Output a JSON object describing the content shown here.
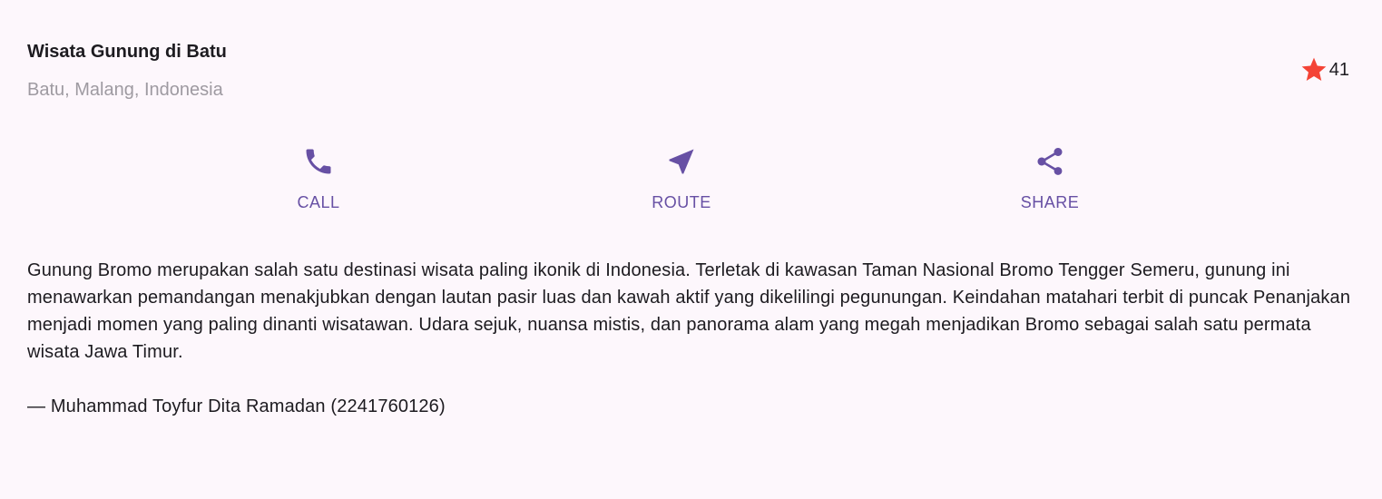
{
  "header": {
    "title": "Wisata Gunung di Batu",
    "location": "Batu, Malang, Indonesia",
    "rating_count": "41",
    "rating_icon": "star-icon",
    "rating_color": "#f44336"
  },
  "actions": [
    {
      "label": "CALL",
      "icon": "phone-icon"
    },
    {
      "label": "ROUTE",
      "icon": "navigation-arrow-icon"
    },
    {
      "label": "SHARE",
      "icon": "share-icon"
    }
  ],
  "accent_color": "#6750a4",
  "description": {
    "text": "Gunung Bromo merupakan salah satu destinasi wisata paling ikonik di Indonesia. Terletak di kawasan Taman Nasional Bromo Tengger Semeru, gunung ini menawarkan pemandangan menakjubkan dengan lautan pasir luas dan kawah aktif yang dikelilingi pegunungan. Keindahan matahari terbit di puncak Penanjakan menjadi momen yang paling dinanti wisatawan. Udara sejuk, nuansa mistis, dan panorama alam yang megah menjadikan Bromo sebagai salah satu permata wisata Jawa Timur.",
    "author": "— Muhammad Toyfur Dita Ramadan (2241760126)"
  }
}
